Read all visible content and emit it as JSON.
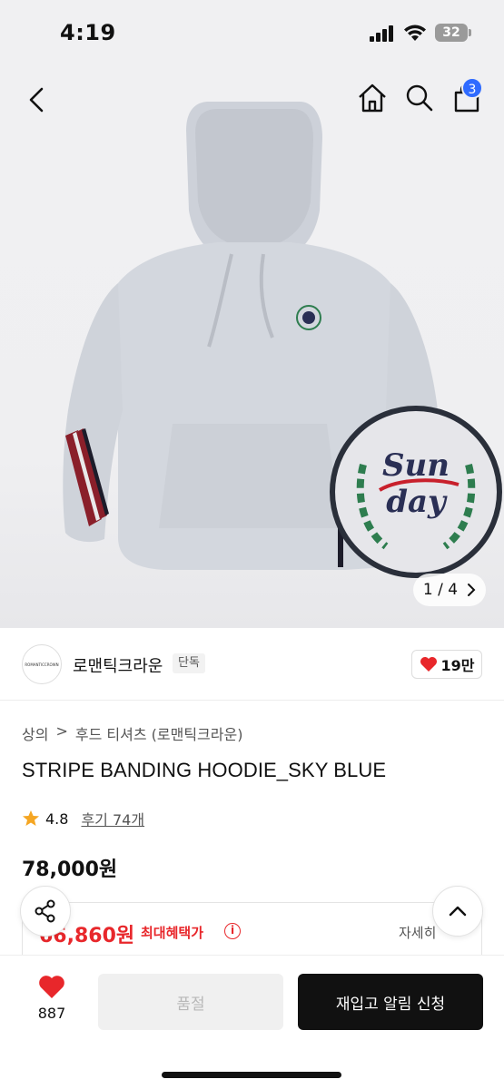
{
  "status_bar": {
    "time": "4:19",
    "battery": "32"
  },
  "header": {
    "back_icon": "chevron-left-icon",
    "home_icon": "home-icon",
    "search_icon": "search-icon",
    "cart_icon": "shopping-bag-icon",
    "cart_badge": "3"
  },
  "gallery": {
    "current": "1",
    "total": "4",
    "separator": "/"
  },
  "brand": {
    "logo_text": "ROMANTICCROWN",
    "name": "로맨틱크라운",
    "tag": "단독",
    "likes": "19만"
  },
  "breadcrumb": {
    "category": "상의",
    "subcategory": "후드 티셔츠 (로맨틱크라운)"
  },
  "product": {
    "title": "STRIPE BANDING HOODIE_SKY BLUE",
    "rating": "4.8",
    "reviews": "후기 74개",
    "price": "78,000원"
  },
  "benefit": {
    "price": "66,860원",
    "label": "최대혜택가",
    "detail": "자세히"
  },
  "bottom_bar": {
    "wish_count": "887",
    "soldout_label": "품절",
    "restock_label": "재입고 알림 신청"
  },
  "colors": {
    "accent_red": "#e8272b",
    "badge_blue": "#2f6bff",
    "dark": "#111111"
  }
}
